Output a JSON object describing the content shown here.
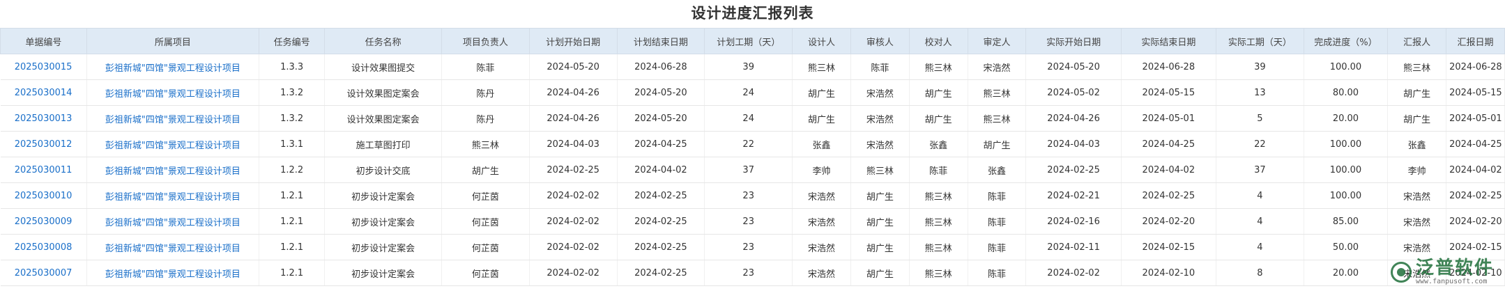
{
  "page": {
    "title": "设计进度汇报列表"
  },
  "table": {
    "columns": [
      "单据编号",
      "所属项目",
      "任务编号",
      "任务名称",
      "项目负责人",
      "计划开始日期",
      "计划结束日期",
      "计划工期（天）",
      "设计人",
      "审核人",
      "校对人",
      "审定人",
      "实际开始日期",
      "实际结束日期",
      "实际工期（天）",
      "完成进度（%）",
      "汇报人",
      "汇报日期"
    ],
    "rows": [
      [
        "2025030015",
        "彭祖新城\"四馆\"景观工程设计项目",
        "1.3.3",
        "设计效果图提交",
        "陈菲",
        "2024-05-20",
        "2024-06-28",
        "39",
        "熊三林",
        "陈菲",
        "熊三林",
        "宋浩然",
        "2024-05-20",
        "2024-06-28",
        "39",
        "100.00",
        "熊三林",
        "2024-06-28"
      ],
      [
        "2025030014",
        "彭祖新城\"四馆\"景观工程设计项目",
        "1.3.2",
        "设计效果图定案会",
        "陈丹",
        "2024-04-26",
        "2024-05-20",
        "24",
        "胡广生",
        "宋浩然",
        "胡广生",
        "熊三林",
        "2024-05-02",
        "2024-05-15",
        "13",
        "80.00",
        "胡广生",
        "2024-05-15"
      ],
      [
        "2025030013",
        "彭祖新城\"四馆\"景观工程设计项目",
        "1.3.2",
        "设计效果图定案会",
        "陈丹",
        "2024-04-26",
        "2024-05-20",
        "24",
        "胡广生",
        "宋浩然",
        "胡广生",
        "熊三林",
        "2024-04-26",
        "2024-05-01",
        "5",
        "20.00",
        "胡广生",
        "2024-05-01"
      ],
      [
        "2025030012",
        "彭祖新城\"四馆\"景观工程设计项目",
        "1.3.1",
        "施工草图打印",
        "熊三林",
        "2024-04-03",
        "2024-04-25",
        "22",
        "张鑫",
        "宋浩然",
        "张鑫",
        "胡广生",
        "2024-04-03",
        "2024-04-25",
        "22",
        "100.00",
        "张鑫",
        "2024-04-25"
      ],
      [
        "2025030011",
        "彭祖新城\"四馆\"景观工程设计项目",
        "1.2.2",
        "初步设计交底",
        "胡广生",
        "2024-02-25",
        "2024-04-02",
        "37",
        "李帅",
        "熊三林",
        "陈菲",
        "张鑫",
        "2024-02-25",
        "2024-04-02",
        "37",
        "100.00",
        "李帅",
        "2024-04-02"
      ],
      [
        "2025030010",
        "彭祖新城\"四馆\"景观工程设计项目",
        "1.2.1",
        "初步设计定案会",
        "何芷茵",
        "2024-02-02",
        "2024-02-25",
        "23",
        "宋浩然",
        "胡广生",
        "熊三林",
        "陈菲",
        "2024-02-21",
        "2024-02-25",
        "4",
        "100.00",
        "宋浩然",
        "2024-02-25"
      ],
      [
        "2025030009",
        "彭祖新城\"四馆\"景观工程设计项目",
        "1.2.1",
        "初步设计定案会",
        "何芷茵",
        "2024-02-02",
        "2024-02-25",
        "23",
        "宋浩然",
        "胡广生",
        "熊三林",
        "陈菲",
        "2024-02-16",
        "2024-02-20",
        "4",
        "85.00",
        "宋浩然",
        "2024-02-20"
      ],
      [
        "2025030008",
        "彭祖新城\"四馆\"景观工程设计项目",
        "1.2.1",
        "初步设计定案会",
        "何芷茵",
        "2024-02-02",
        "2024-02-25",
        "23",
        "宋浩然",
        "胡广生",
        "熊三林",
        "陈菲",
        "2024-02-11",
        "2024-02-15",
        "4",
        "50.00",
        "宋浩然",
        "2024-02-15"
      ],
      [
        "2025030007",
        "彭祖新城\"四馆\"景观工程设计项目",
        "1.2.1",
        "初步设计定案会",
        "何芷茵",
        "2024-02-02",
        "2024-02-25",
        "23",
        "宋浩然",
        "胡广生",
        "熊三林",
        "陈菲",
        "2024-02-02",
        "2024-02-10",
        "8",
        "20.00",
        "宋浩然",
        "2024-02-10"
      ]
    ]
  },
  "watermark": {
    "name": "泛普软件",
    "url": "www.fanpusoft.com",
    "icon": "fanpu-logo-icon",
    "color": "#1f6f3a"
  },
  "colors": {
    "header_bg": "#dfeaf5",
    "link": "#1a6fc9"
  }
}
